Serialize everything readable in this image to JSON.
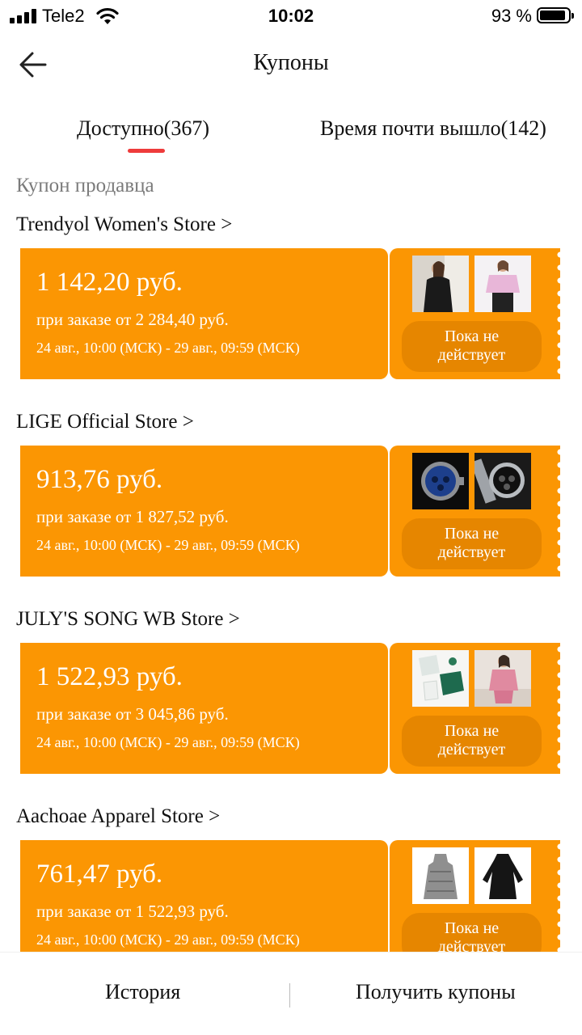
{
  "status_bar": {
    "carrier": "Tele2",
    "time": "10:02",
    "battery": "93 %",
    "icons": [
      "signal-icon",
      "wifi-icon",
      "battery-icon"
    ]
  },
  "header": {
    "title": "Купоны",
    "back_icon": "arrow-left-icon"
  },
  "tabs": [
    {
      "label": "Доступно(367)",
      "active": true
    },
    {
      "label": "Время почти вышло(142)",
      "active": false
    }
  ],
  "section_label": "Купон продавца",
  "coupons": [
    {
      "store": "Trendyol Women's Store >",
      "amount": "1 142,20 руб.",
      "condition": "при заказе от 2 284,40 руб.",
      "validity": "24 авг., 10:00 (МСК) - 29 авг., 09:59 (МСК)",
      "status_line1": "Пока не",
      "status_line2": "действует",
      "thumbs": [
        "black-dress-product-image",
        "pink-tshirt-product-image"
      ]
    },
    {
      "store": "LIGE Official Store >",
      "amount": "913,76 руб.",
      "condition": "при заказе от 1 827,52 руб.",
      "validity": "24 авг., 10:00 (МСК) - 29 авг., 09:59 (МСК)",
      "status_line1": "Пока не",
      "status_line2": "действует",
      "thumbs": [
        "blue-watch-product-image",
        "silver-watch-product-image"
      ]
    },
    {
      "store": "JULY'S SONG WB Store >",
      "amount": "1 522,93 руб.",
      "condition": "при заказе от 3 045,86 руб.",
      "validity": "24 авг., 10:00 (МСК) - 29 авг., 09:59 (МСК)",
      "status_line1": "Пока не",
      "status_line2": "действует",
      "thumbs": [
        "green-pajama-set-product-image",
        "pink-pajama-product-image"
      ]
    },
    {
      "store": "Aachoae Apparel Store >",
      "amount": "761,47 руб.",
      "condition": "при заказе от 1 522,93 руб.",
      "validity": "24 авг., 10:00 (МСК) - 29 авг., 09:59 (МСК)",
      "status_line1": "Пока не",
      "status_line2": "действует",
      "thumbs": [
        "grey-dress-product-image",
        "black-dress-product-image"
      ]
    }
  ],
  "bottom_bar": {
    "history": "История",
    "get_coupons": "Получить купоны"
  },
  "colors": {
    "coupon_bg": "#fb9603",
    "coupon_button": "#e68600",
    "tab_indicator": "#ee3b3b",
    "section_label": "#7b7b7b"
  }
}
